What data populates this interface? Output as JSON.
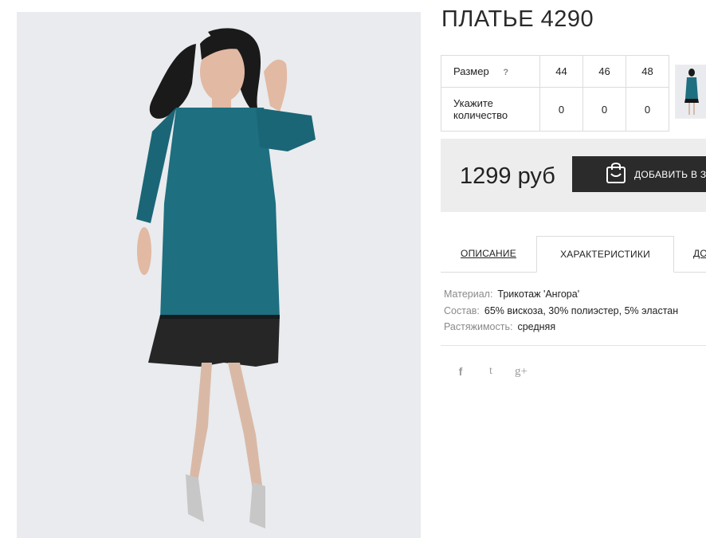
{
  "product": {
    "title": "ПЛАТЬЕ 4290",
    "photo_alt": "Teal knit dress with black tulle hem"
  },
  "size_table": {
    "size_label": "Размер",
    "help_icon": "?",
    "sizes": [
      "44",
      "46",
      "48"
    ],
    "quantity_label_line1": "Укажите",
    "quantity_label_line2": "количество",
    "quantities": [
      "0",
      "0",
      "0"
    ]
  },
  "price": {
    "value": "1299 руб",
    "add_button_label": "ДОБАВИТЬ В З"
  },
  "tabs": {
    "description": "ОПИСАНИЕ",
    "characteristics": "ХАРАКТЕРИСТИКИ",
    "third": "ДО"
  },
  "characteristics": [
    {
      "key": "Материал:",
      "value": "Трикотаж 'Ангора'"
    },
    {
      "key": "Состав:",
      "value": "65% вискоза, 30% полиэстер, 5% эластан"
    },
    {
      "key": "Растяжимость:",
      "value": "средняя"
    }
  ],
  "social": {
    "facebook": "f",
    "twitter": "t",
    "googleplus": "g+"
  },
  "colors": {
    "dress": "#1e6f80",
    "button": "#2b2b2b",
    "price_bg": "#ededed"
  }
}
